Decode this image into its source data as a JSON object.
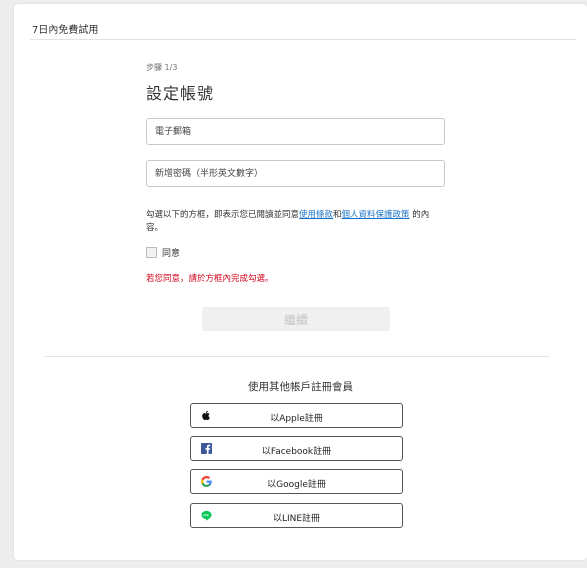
{
  "card": {
    "title": "7日內免費試用"
  },
  "form": {
    "step": "步驟 1/3",
    "heading": "設定帳號",
    "email_placeholder": "電子郵箱",
    "password_placeholder": "新增密碼（半形英文數字）",
    "terms": {
      "prefix": "勾選以下的方框，即表示您已閱讀並同意",
      "link1": "使用條款",
      "mid": "和",
      "link2": "個人資料保護政策",
      "suffix": "的內容。"
    },
    "agree_label": "同意",
    "error": "若您同意，請於方框內完成勾選。",
    "continue_label": "繼續"
  },
  "social": {
    "title": "使用其他帳戶註冊會員",
    "apple": "以Apple註冊",
    "facebook": "以Facebook註冊",
    "google": "以Google註冊",
    "line": "以LINE註冊"
  },
  "colors": {
    "link": "#1a73c8",
    "error": "#d0021b",
    "facebook": "#3b5998",
    "line": "#06c755"
  },
  "icons": [
    "apple-icon",
    "facebook-icon",
    "google-icon",
    "line-icon"
  ]
}
